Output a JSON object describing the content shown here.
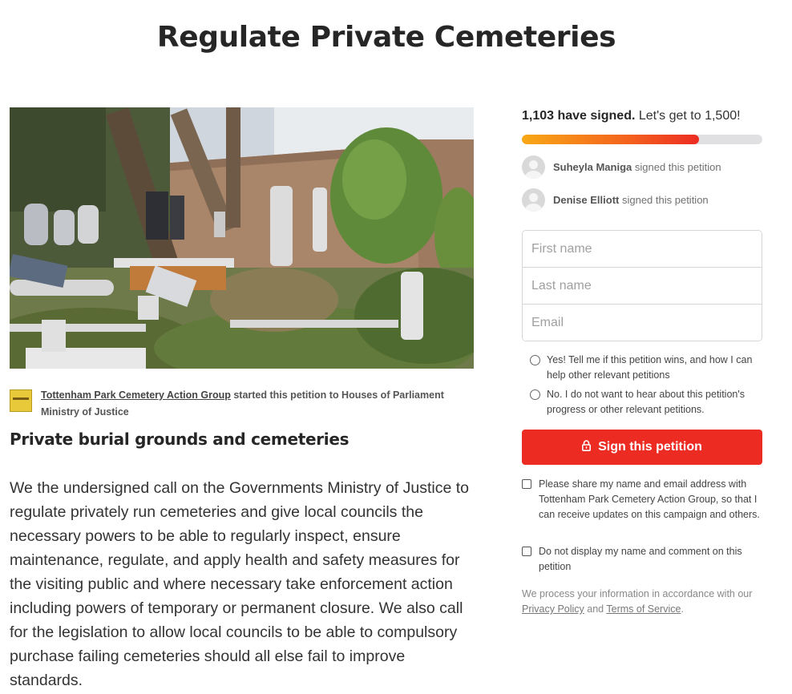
{
  "page": {
    "title": "Regulate Private Cemeteries"
  },
  "hero": {
    "alt": "Overgrown cemetery with headstones among weeds and bushes"
  },
  "starter": {
    "organization": "Tottenham Park Cemetery Action Group",
    "started_text": " started this petition to Houses of Parliament",
    "target": "Ministry of Justice"
  },
  "petition": {
    "subtitle": "Private burial grounds and cemeteries",
    "body": "We the undersigned call on the Governments Ministry of Justice to regulate privately run cemeteries and give local councils the necessary powers to be able to regularly inspect, ensure maintenance, regulate, and apply health and safety measures for the visiting public and where necessary take enforcement action including powers of temporary or permanent closure. We also call for the legislation to allow local councils to be able to compulsory purchase failing cemeteries should all else fail to improve standards."
  },
  "progress": {
    "signed_count": "1,103 have signed.",
    "goal_text": " Let's get to 1,500!",
    "fraction": 0.7353
  },
  "recent_signers": [
    {
      "name": "Suheyla Maniga",
      "action": " signed this petition"
    },
    {
      "name": "Denise Elliott",
      "action": " signed this petition"
    }
  ],
  "form": {
    "first_name_placeholder": "First name",
    "last_name_placeholder": "Last name",
    "email_placeholder": "Email",
    "radio_yes": "Yes! Tell me if this petition wins, and how I can help other relevant petitions",
    "radio_no": "No. I do not want to hear about this petition's progress or other relevant petitions.",
    "sign_button": "Sign this petition",
    "share_checkbox": "Please share my name and email address with Tottenham Park Cemetery Action Group, so that I can receive updates on this campaign and others.",
    "hide_checkbox": "Do not display my name and comment on this petition"
  },
  "privacy": {
    "prefix": "We process your information in accordance with our ",
    "privacy_link": "Privacy Policy",
    "and": " and ",
    "terms_link": "Terms of Service",
    "suffix": "."
  },
  "colors": {
    "primary": "#ec2c22",
    "progress_start": "#f8a816",
    "progress_track": "#e0dfe2"
  }
}
